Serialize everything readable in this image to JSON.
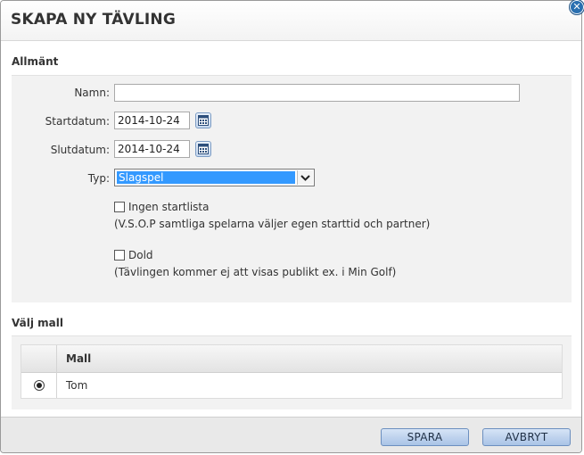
{
  "dialog": {
    "title": "SKAPA NY TÄVLING",
    "close_icon": "close-icon"
  },
  "general": {
    "heading": "Allmänt",
    "name_label": "Namn:",
    "name_value": "",
    "start_label": "Startdatum:",
    "start_value": "2014-10-24",
    "end_label": "Slutdatum:",
    "end_value": "2014-10-24",
    "type_label": "Typ:",
    "type_selected": "Slagspel",
    "no_startlist_label": "Ingen startlista",
    "no_startlist_checked": false,
    "no_startlist_hint": "(V.S.O.P samtliga spelarna väljer egen starttid och partner)",
    "hidden_label": "Dold",
    "hidden_checked": false,
    "hidden_hint": "(Tävlingen kommer ej att visas publikt ex. i Min Golf)"
  },
  "template": {
    "heading": "Välj mall",
    "column_header": "Mall",
    "rows": [
      {
        "label": "Tom",
        "selected": true
      }
    ]
  },
  "footer": {
    "save_label": "SPARA",
    "cancel_label": "AVBRYT"
  },
  "colors": {
    "select_highlight": "#3399ff",
    "button_fill": "#b7cdea",
    "close_button": "#2a6fb0"
  }
}
